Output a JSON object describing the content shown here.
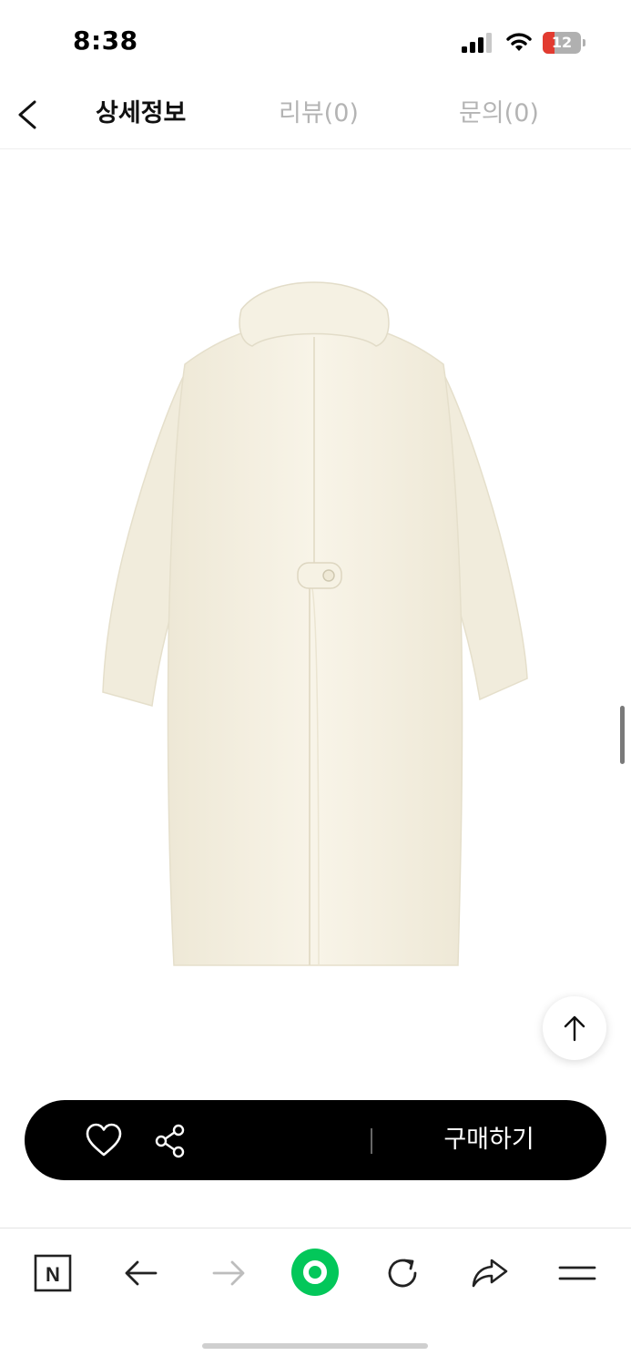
{
  "status_bar": {
    "time": "8:38",
    "battery_level": "12",
    "battery_color": "#e23b30",
    "icons": [
      "signal-icon",
      "wifi-icon",
      "battery-icon"
    ]
  },
  "header": {
    "back_icon": "chevron-left-icon",
    "tabs": [
      {
        "label": "상세정보",
        "active": true
      },
      {
        "label": "리뷰(0)",
        "active": false
      },
      {
        "label": "문의(0)",
        "active": false
      }
    ]
  },
  "product": {
    "image": "cream wool long coat, back view",
    "color": "#f6f2e4"
  },
  "scroll_top_icon": "arrow-up-icon",
  "purchase_bar": {
    "like_icon": "heart-icon",
    "share_icon": "share-icon",
    "buy_label": "구매하기",
    "background": "#000000"
  },
  "browser_bar": {
    "n_icon_label": "N",
    "icons": [
      "naver-n-icon",
      "back-arrow-icon",
      "forward-arrow-icon",
      "green-dot-icon",
      "reload-icon",
      "share-forward-icon",
      "menu-icon"
    ],
    "accent": "#03c75a"
  }
}
